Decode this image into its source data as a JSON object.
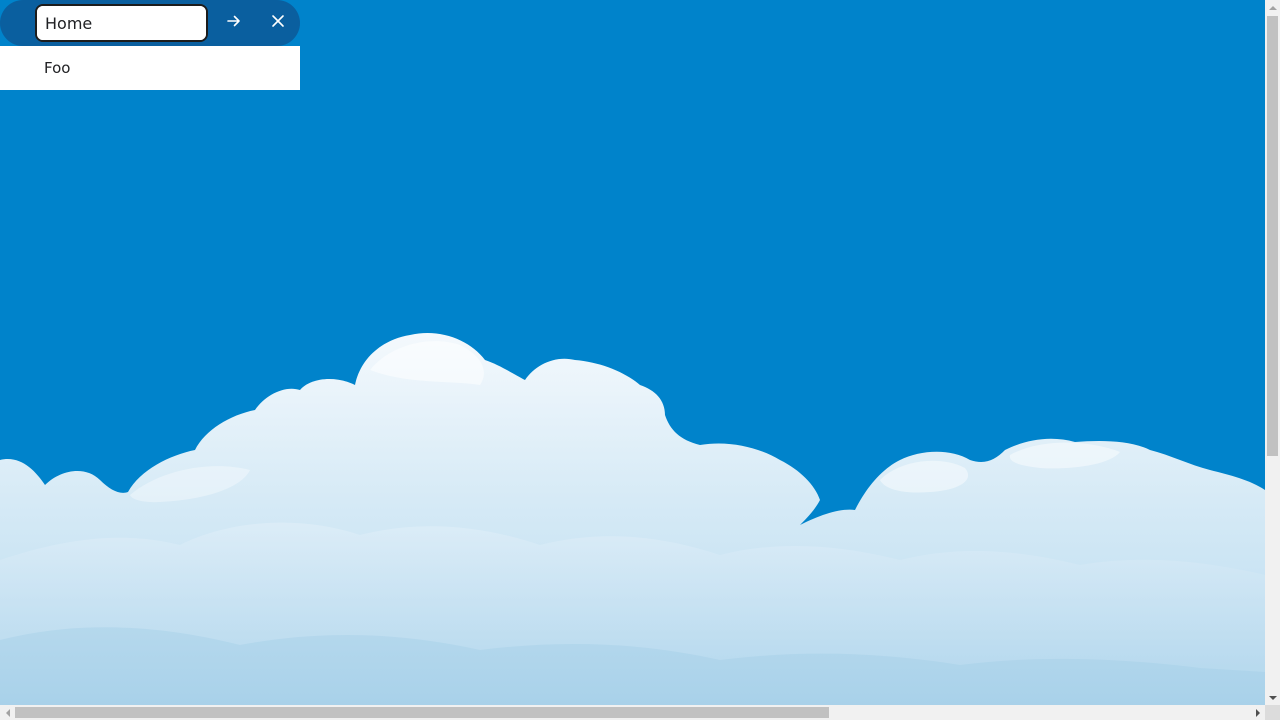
{
  "colors": {
    "sky": "#0083cb",
    "search_bar_bg": "#0a5f9f",
    "dropdown_bg": "#ffffff",
    "text": "#202124"
  },
  "search": {
    "value": "Home",
    "go_icon": "arrow-right-icon",
    "close_icon": "close-icon"
  },
  "suggestions": [
    {
      "label": "Foo"
    }
  ],
  "scrollbars": {
    "vertical_icons": [
      "arrow-up-icon",
      "arrow-down-icon"
    ],
    "horizontal_icons": [
      "arrow-left-icon",
      "arrow-right-icon"
    ]
  }
}
